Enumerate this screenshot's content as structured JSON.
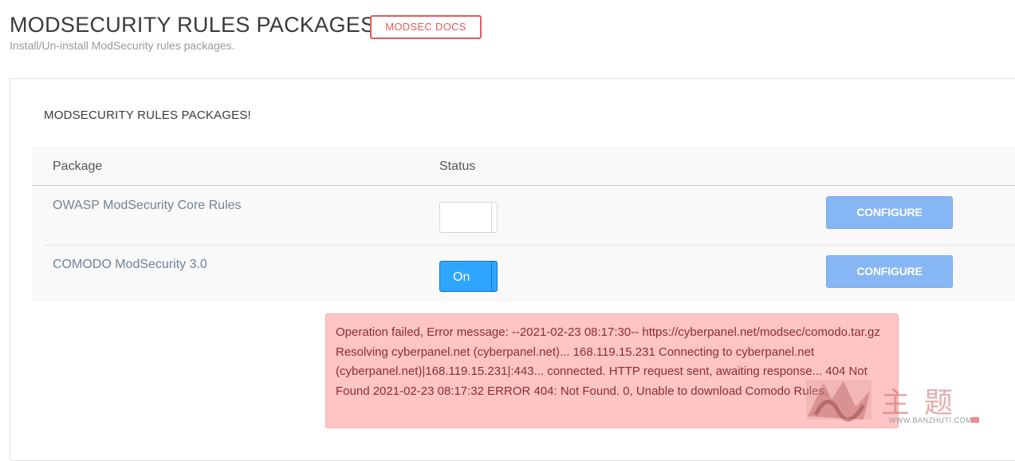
{
  "header": {
    "title": "MODSECURITY RULES PACKAGES! -",
    "docs_button": "MODSEC DOCS",
    "subtitle": "Install/Un-install ModSecurity rules packages."
  },
  "panel": {
    "title": "MODSECURITY RULES PACKAGES!",
    "table": {
      "headers": [
        "Package",
        "Status"
      ],
      "rows": [
        {
          "name": "OWASP ModSecurity Core Rules",
          "status": "off",
          "toggle_label": "",
          "action": "CONFIGURE"
        },
        {
          "name": "COMODO ModSecurity 3.0",
          "status": "on",
          "toggle_label": "On",
          "action": "CONFIGURE"
        }
      ]
    },
    "error_message": "Operation failed, Error message: --2021-02-23 08:17:30-- https://cyberpanel.net/modsec/comodo.tar.gz Resolving cyberpanel.net (cyberpanel.net)... 168.119.15.231 Connecting to cyberpanel.net (cyberpanel.net)|168.119.15.231|:443... connected. HTTP request sent, awaiting response... 404 Not Found 2021-02-23 08:17:32 ERROR 404: Not Found. 0, Unable to download Comodo Rules."
  },
  "watermark": {
    "chinese_text": "主题",
    "url": "WWW.BANZHUTI.COM"
  },
  "colors": {
    "docs_border": "#e85a5a",
    "toggle_on": "#2fa6ff",
    "configure_button": "#87b6f4",
    "error_background": "#ffc4c4",
    "package_name": "#6f8492"
  }
}
